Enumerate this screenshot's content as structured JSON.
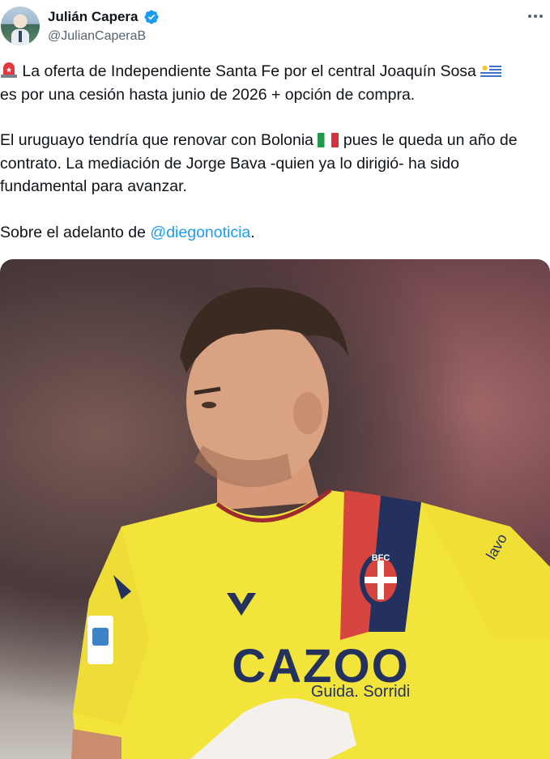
{
  "author": {
    "display_name": "Julián Capera",
    "handle": "@JulianCaperaB",
    "verified": true
  },
  "tweet": {
    "line1": "La oferta de Independiente Santa Fe por el central Joaquín Sosa",
    "line2": "es por una cesión hasta junio de 2026 + opción de compra.",
    "line3_before_flag": "El uruguayo tendría que renovar con Bolonia",
    "line3_after_flag": "pues le queda un año de",
    "line4": "contrato. La mediación de Jorge Bava -quien ya lo dirigió- ha sido",
    "line5": "fundamental para avanzar.",
    "line6_prefix": "Sobre el adelanto de",
    "mention": "@diegonoticia",
    "line6_suffix": "."
  },
  "media": {
    "sponsor": "CAZOO",
    "sponsor_tagline": "Guida. Sorridi",
    "crest": "BFC",
    "sleeve_text": "lavo"
  },
  "colors": {
    "accent": "#1d9bf0",
    "jersey": "#f2e43a",
    "text": "#0f1419",
    "secondary": "#536471"
  },
  "icons": {
    "siren": "siren-emoji",
    "uruguay_flag": "uruguay-flag-emoji",
    "italy_flag": "italy-flag-emoji",
    "verified": "verified-badge-icon",
    "more": "more-options-icon"
  }
}
